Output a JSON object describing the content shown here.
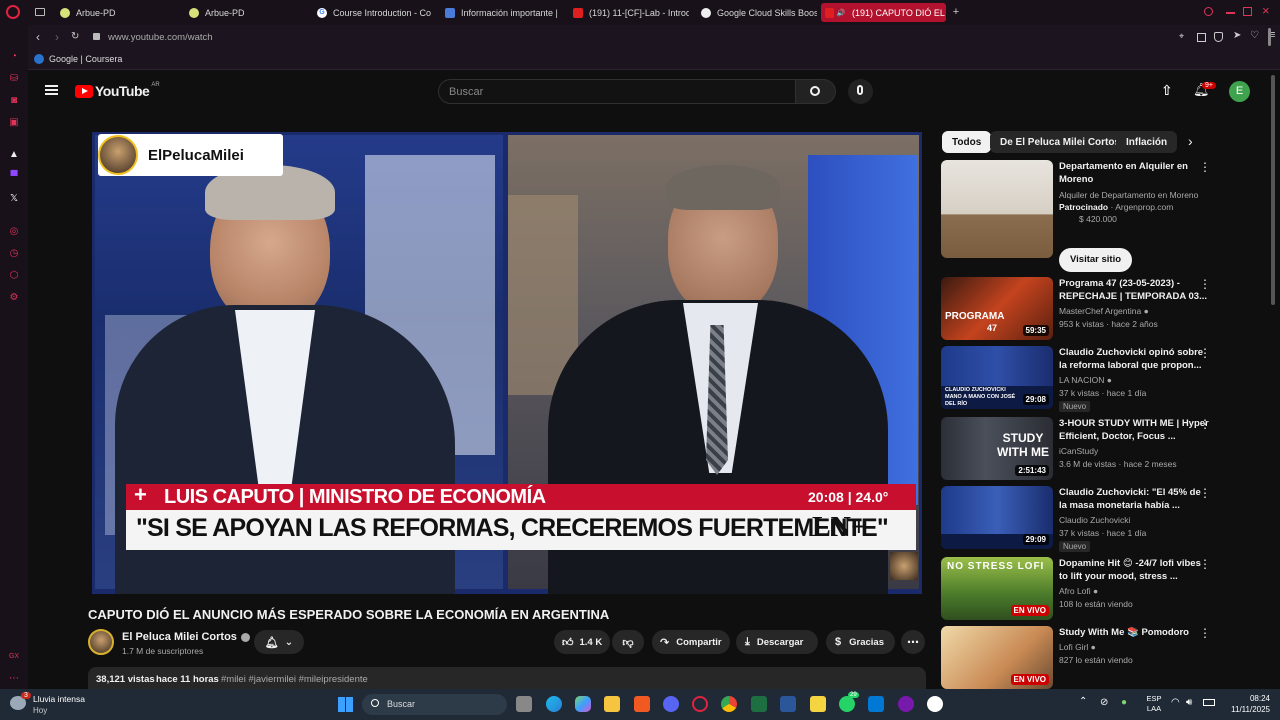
{
  "browser": {
    "tabs": [
      {
        "label": "Arbue-PD",
        "active": false
      },
      {
        "label": "Arbue-PD",
        "active": false
      },
      {
        "label": "Course Introduction - Co",
        "active": false
      },
      {
        "label": "Información importante |",
        "active": false
      },
      {
        "label": "(191) 11-[CF]-Lab - Introd",
        "active": false
      },
      {
        "label": "Google Cloud Skills Boos",
        "active": false
      },
      {
        "label": "(191) CAPUTO DIÓ EL",
        "active": true
      }
    ],
    "url": "www.youtube.com/watch",
    "bookmark": "Google | Coursera"
  },
  "youtube": {
    "logo": "YouTube",
    "region": "AR",
    "search_placeholder": "Buscar",
    "notif_count": "9+",
    "avatar_letter": "E",
    "video": {
      "overlay_brand": "ElPelucaMilei",
      "lower_third_name": "LUIS CAPUTO | MINISTRO DE ECONOMÍA",
      "lower_third_quote": "\"SI SE APOYAN LAS REFORMAS, CRECEREMOS FUERTEMENTE\"",
      "lower_third_time": "20:08 | 24.0°",
      "lower_third_logo": "LN+",
      "title": "CAPUTO DIÓ EL ANUNCIO MÁS ESPERADO SOBRE LA ECONOMÍA EN ARGENTINA",
      "channel": "El Peluca Milei Cortos",
      "subscribers": "1.7 M de suscriptores",
      "likes": "1.4 K",
      "share_label": "Compartir",
      "download_label": "Descargar",
      "thanks_label": "Gracias",
      "views": "38,121 vistas",
      "age": "hace 11 horas",
      "hashtags": "#milei #javiermilei #mileipresidente"
    },
    "chips": [
      "Todos",
      "De El Peluca Milei Cortos",
      "Inflación"
    ],
    "ad": {
      "title": "Departamento en Alquiler en Moreno",
      "subtitle": "Alquiler de Departamento en Moreno",
      "sponsored": "Patrocinado",
      "domain": "· Argenprop.com",
      "price": "$ 420.000",
      "cta": "Visitar sitio"
    },
    "recs": [
      {
        "title": "Programa 47 (23-05-2023) - REPECHAJE | TEMPORADA 03...",
        "channel": "MasterChef Argentina",
        "meta": "953 k vistas · hace 2 años",
        "duration": "59:35",
        "badge": ""
      },
      {
        "title": "Claudio Zuchovicki opinó sobre la reforma laboral que propon...",
        "channel": "LA NACION",
        "meta": "37 k vistas · hace 1 día",
        "duration": "29:08",
        "badge": "Nuevo"
      },
      {
        "title": "3-HOUR STUDY WITH ME | Hyper Efficient, Doctor, Focus ...",
        "channel": "iCanStudy",
        "meta": "3.6 M de vistas · hace 2 meses",
        "duration": "2:51:43",
        "badge": ""
      },
      {
        "title": "Claudio Zuchovicki: \"El 45% de la masa monetaria había ...",
        "channel": "Claudio Zuchovicki",
        "meta": "37 k vistas · hace 1 día",
        "duration": "29:09",
        "badge": "Nuevo"
      },
      {
        "title": "Dopamine Hit 😊 -24/7 lofi vibes to lift your mood, stress ...",
        "channel": "Afro Lofi",
        "meta": "108 lo están viendo",
        "duration": "EN VIVO",
        "badge": ""
      },
      {
        "title": "Study With Me 📚 Pomodoro",
        "channel": "Lofi Girl",
        "meta": "827 lo están viendo",
        "duration": "EN VIVO",
        "badge": ""
      }
    ],
    "thumb_texts": {
      "programa": "PROGRAMA",
      "programa_num": "47",
      "study": "STUDY WITH ME",
      "lofi": "NO STRESS LOFI",
      "ln1": "CLAUDIO ZUCHOVICKI MANO A MANO CON JOSÉ DEL RÍO"
    }
  },
  "taskbar": {
    "weather_title": "Lluvia intensa",
    "weather_sub": "Hoy",
    "weather_badge": "3",
    "search": "Buscar",
    "lang": "ESP",
    "lang_sub": "LAA",
    "time": "08:24",
    "date": "11/11/2025",
    "whatsapp_badge": "29"
  }
}
